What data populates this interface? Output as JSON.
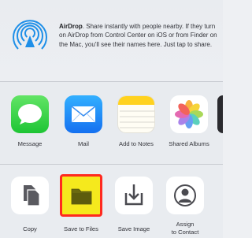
{
  "airdrop": {
    "title": "AirDrop",
    "description": ". Share instantly with people nearby. If they turn on AirDrop from Control Center on iOS or from Finder on the Mac, you'll see their names here. Just tap to share."
  },
  "apps": [
    {
      "label": "Message",
      "icon": "messages-icon"
    },
    {
      "label": "Mail",
      "icon": "mail-icon"
    },
    {
      "label": "Add to Notes",
      "icon": "notes-icon"
    },
    {
      "label": "Shared Albums",
      "icon": "photos-icon"
    }
  ],
  "actions": [
    {
      "label": "Copy",
      "icon": "copy-icon"
    },
    {
      "label": "Save to Files",
      "icon": "folder-icon",
      "highlighted": true
    },
    {
      "label": "Save Image",
      "icon": "save-image-icon"
    },
    {
      "label_line1": "Assign",
      "label_line2": "to Contact",
      "icon": "contact-icon"
    }
  ],
  "colors": {
    "airdrop_blue": "#1e8fe8",
    "highlight_border": "#ff2a1f",
    "highlight_fill": "#f5e91d"
  }
}
